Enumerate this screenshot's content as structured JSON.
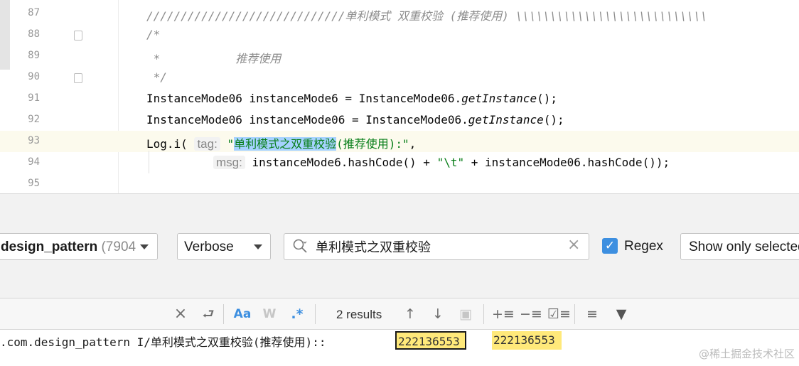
{
  "editor": {
    "lines": [
      {
        "number": "87",
        "text": "/////////////////////////////单利模式 双重校验 (推荐使用) \\\\\\\\\\\\\\\\\\\\\\\\\\\\\\\\\\\\\\\\\\\\\\\\\\\\\\\\"
      },
      {
        "number": "88",
        "text": "/*"
      },
      {
        "number": "89",
        "text": " *           推荐使用"
      },
      {
        "number": "90",
        "text": " */"
      },
      {
        "number": "91",
        "text_prefix": "InstanceMode06 instanceMode6 = InstanceMode06.",
        "method": "getInstance",
        "text_suffix": "();"
      },
      {
        "number": "92",
        "text_prefix": "InstanceMode06 instanceMode06 = InstanceMode06.",
        "method": "getInstance",
        "text_suffix": "();"
      },
      {
        "number": "93",
        "call": "Log.i(",
        "hint": "tag:",
        "quote_open": "\"",
        "highlight": "单利模式之双重校验",
        "string_rest": "(推荐使用):\"",
        "tail": ","
      },
      {
        "number": "94",
        "hint": "msg:",
        "text": "instanceMode6.hashCode() + ",
        "string": "\"\\t\"",
        "text_suffix": " + instanceMode06.hashCode());"
      },
      {
        "number": "95",
        "text": ""
      }
    ]
  },
  "logcat": {
    "process_name": "design_pattern",
    "process_pid": "(7904",
    "log_level": "Verbose",
    "search_value": "单利模式之双重校验",
    "regex_label": "Regex",
    "regex_checked": true,
    "filter_label": "Show only selected"
  },
  "findbar": {
    "clear_icon": "×",
    "results": "2 results"
  },
  "log_output": {
    "line_text": ".com.design_pattern I/单利模式之双重校验(推荐使用):: ",
    "match_1": "222136553",
    "match_2": "222136553"
  },
  "watermark": "@稀土掘金技术社区",
  "colors": {
    "accent": "#3d8fe0",
    "selection": "#a6d2ff",
    "match_highlight": "#ffe97a",
    "current_line": "#fcfaed",
    "string": "#067d17",
    "comment": "#8c8c8c"
  }
}
